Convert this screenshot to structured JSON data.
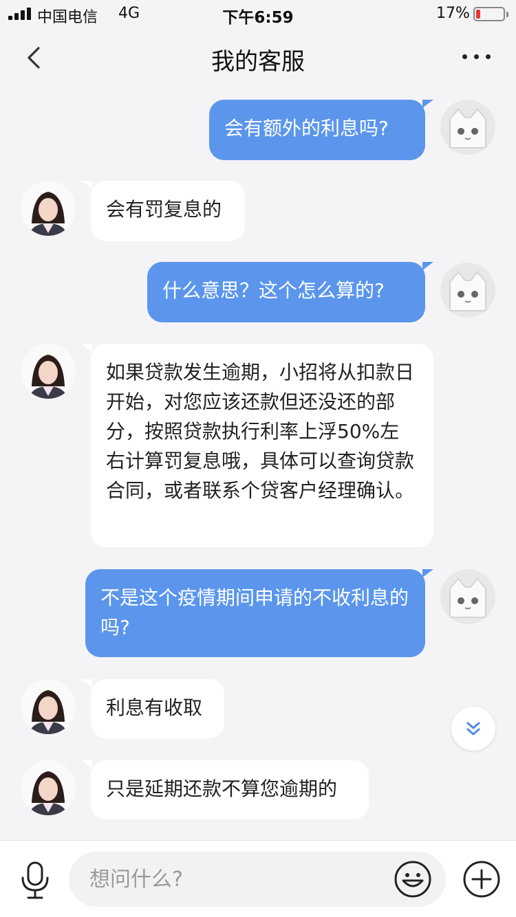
{
  "status_bar": {
    "carrier": "中国电信",
    "network": "4G",
    "time": "下午6:59",
    "battery_percent": "17%",
    "battery_level": 0.17
  },
  "nav": {
    "title": "我的客服"
  },
  "messages": [
    {
      "sender": "user",
      "text": "会有额外的利息吗?"
    },
    {
      "sender": "agent",
      "text": "会有罚复息的"
    },
    {
      "sender": "user",
      "text": "什么意思？这个怎么算的?"
    },
    {
      "sender": "agent",
      "text": "如果贷款发生逾期，小招将从扣款日开始，对您应该还款但还没还的部分，按照贷款执行利率上浮50%左右计算罚复息哦，具体可以查询贷款合同，或者联系个贷客户经理确认。"
    },
    {
      "sender": "user",
      "text": "不是这个疫情期间申请的不收利息的吗?"
    },
    {
      "sender": "agent",
      "text": "利息有收取"
    },
    {
      "sender": "agent",
      "text": "只是延期还款不算您逾期的"
    }
  ],
  "input": {
    "placeholder": "想问什么?"
  },
  "colors": {
    "user_bubble": "#5b96ec",
    "agent_bubble": "#ffffff",
    "background": "#f4f4f6",
    "accent": "#4a8be8",
    "battery_low": "#e53935"
  },
  "icons": [
    "back-icon",
    "more-icon",
    "mic-icon",
    "emoji-icon",
    "plus-icon",
    "double-chevron-down-icon"
  ]
}
